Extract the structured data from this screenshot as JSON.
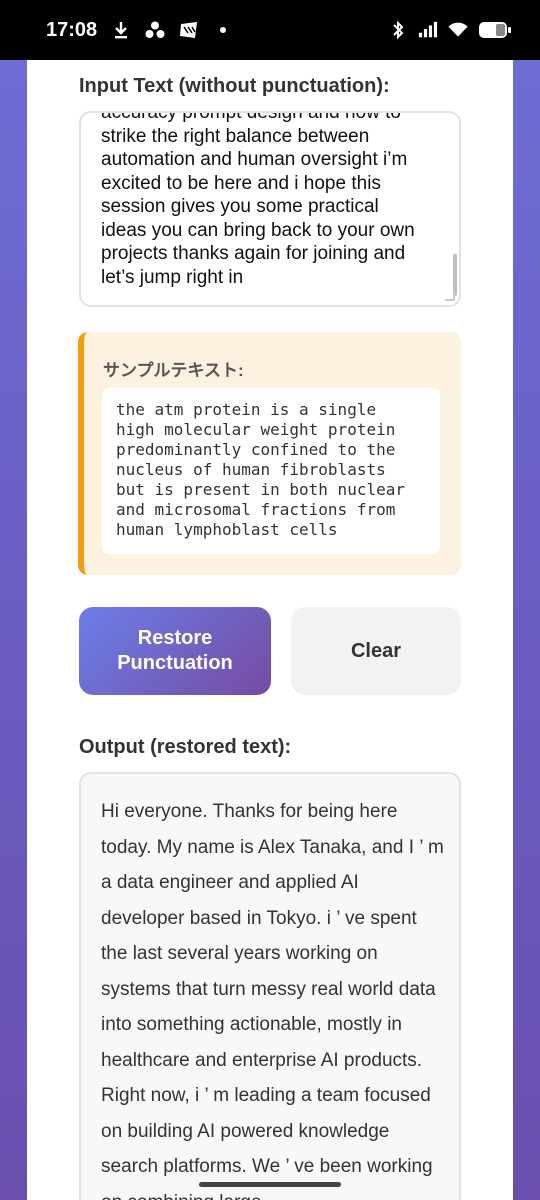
{
  "status_bar": {
    "time": "17:08",
    "left_icons": [
      "download-icon",
      "apps-icon",
      "nyt-icon",
      "dot-icon"
    ],
    "right_icons": [
      "bluetooth-icon",
      "signal-icon",
      "wifi-icon",
      "battery-icon"
    ]
  },
  "input_section": {
    "label": "Input Text (without punctuation):",
    "value": "accuracy prompt design and how to\nstrike the right balance between\nautomation and human oversight i’m\nexcited to be here and i hope this\nsession gives you some practical\nideas you can bring back to your own\nprojects thanks again for joining and\nlet’s jump right in"
  },
  "sample": {
    "title": "サンプルテキスト:",
    "text": "the atm protein is a single\nhigh molecular weight protein\npredominantly confined to the\nnucleus of human fibroblasts\nbut is present in both nuclear\nand microsomal fractions from\nhuman lymphoblast cells"
  },
  "buttons": {
    "restore_label": "Restore Punctuation",
    "clear_label": "Clear"
  },
  "output_section": {
    "label": "Output (restored text):",
    "value": "Hi everyone. Thanks for being here today. My name is Alex Tanaka, and I ’ m a data engineer and applied AI developer based in Tokyo. i ’ ve spent the last several years working on systems that turn messy real world data into something actionable, mostly in healthcare and enterprise AI products. Right now, i ’ m leading a team focused on building AI powered knowledge search platforms. We ’ ve been working on combining large"
  },
  "colors": {
    "accent_start": "#6b7fe8",
    "accent_end": "#764ba2",
    "sample_border": "#f39c12",
    "sample_bg": "#fdf1e0"
  }
}
